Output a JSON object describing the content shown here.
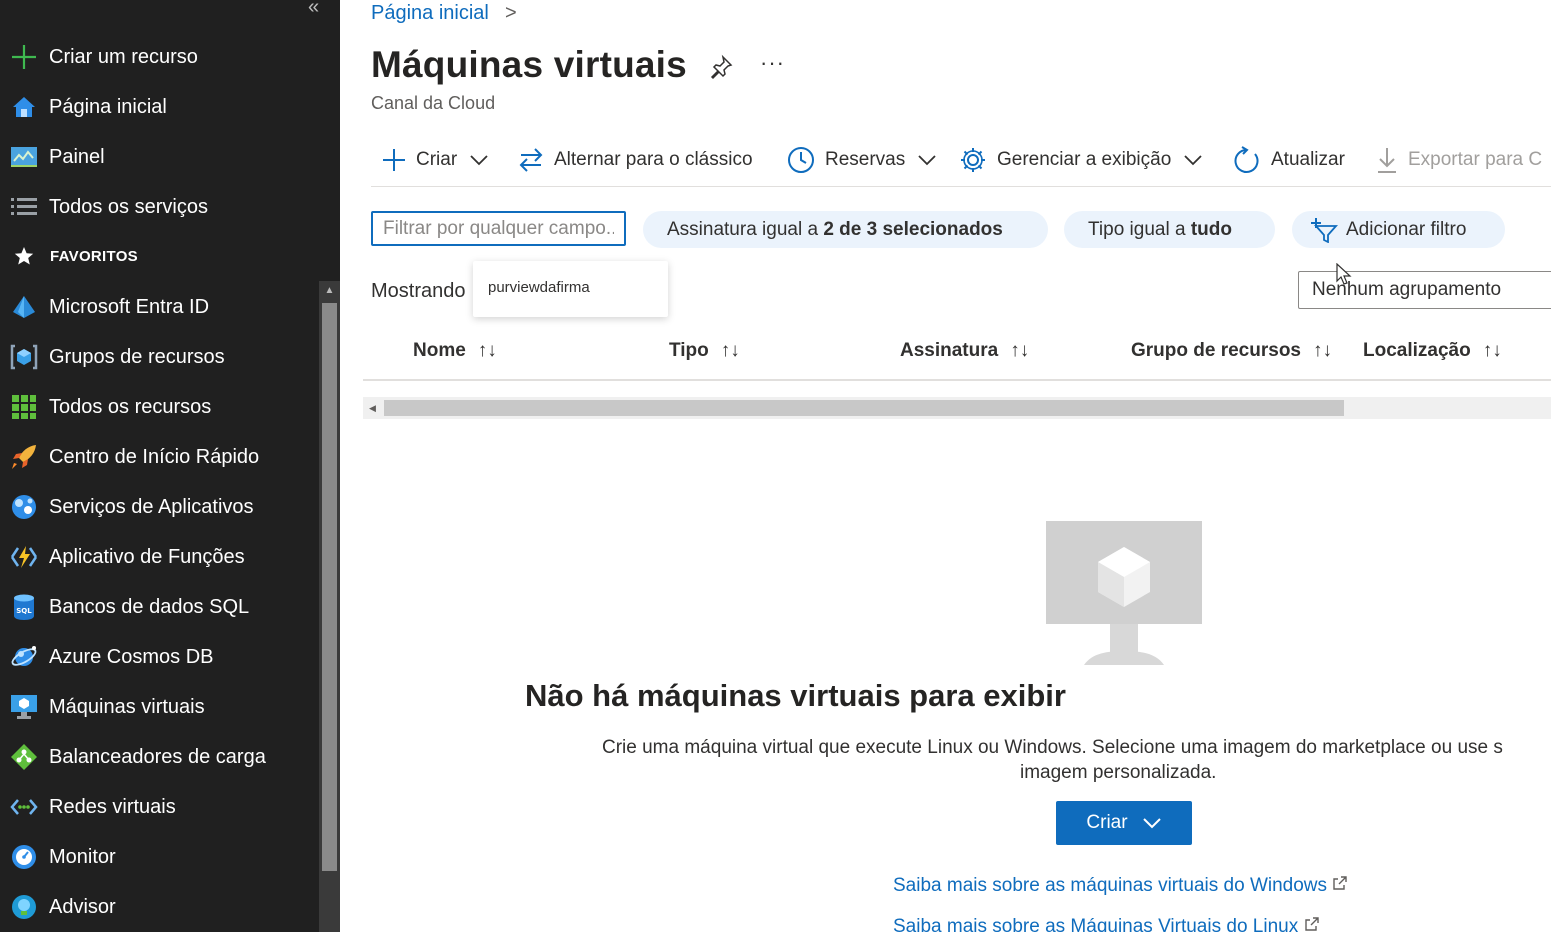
{
  "sidebar": {
    "collapse_icon": "«",
    "create_resource": "Criar um recurso",
    "home": "Página inicial",
    "dashboard": "Painel",
    "all_services": "Todos os serviços",
    "favorites_header": "FAVORITOS",
    "favorites": [
      {
        "label": "Microsoft Entra ID",
        "icon": "entra-id-icon"
      },
      {
        "label": "Grupos de recursos",
        "icon": "resource-groups-icon"
      },
      {
        "label": "Todos os recursos",
        "icon": "all-resources-icon"
      },
      {
        "label": "Centro de Início Rápido",
        "icon": "quickstart-rocket-icon"
      },
      {
        "label": "Serviços de Aplicativos",
        "icon": "app-services-icon"
      },
      {
        "label": "Aplicativo de Funções",
        "icon": "function-app-icon"
      },
      {
        "label": "Bancos de dados SQL",
        "icon": "sql-database-icon"
      },
      {
        "label": "Azure Cosmos DB",
        "icon": "cosmos-db-icon"
      },
      {
        "label": "Máquinas virtuais",
        "icon": "virtual-machine-icon"
      },
      {
        "label": "Balanceadores de carga",
        "icon": "load-balancer-icon"
      },
      {
        "label": "Redes virtuais",
        "icon": "virtual-network-icon"
      },
      {
        "label": "Monitor",
        "icon": "monitor-icon"
      },
      {
        "label": "Advisor",
        "icon": "advisor-icon"
      }
    ]
  },
  "breadcrumb": {
    "home": "Página inicial",
    "separator": ">"
  },
  "page": {
    "title": "Máquinas virtuais",
    "subtitle": "Canal da Cloud",
    "more": "···"
  },
  "toolbar": {
    "create": "Criar",
    "switch_classic": "Alternar para o clássico",
    "reservations": "Reservas",
    "manage_view": "Gerenciar a exibição",
    "refresh": "Atualizar",
    "export": "Exportar para C"
  },
  "filters": {
    "search_placeholder": "Filtrar por qualquer campo...",
    "subscription_prefix": "Assinatura igual a ",
    "subscription_value": "2 de 3 selecionados",
    "type_prefix": "Tipo igual a ",
    "type_value": "tudo",
    "add_filter": "Adicionar filtro"
  },
  "list": {
    "showing": "Mostrando",
    "suggestion": "purviewdafirma",
    "grouping": "Nenhum agrupamento",
    "columns": [
      "Nome",
      "Tipo",
      "Assinatura",
      "Grupo de recursos",
      "Localização"
    ],
    "sort_icon": "↑↓"
  },
  "empty_state": {
    "title": "Não há máquinas virtuais para exibir",
    "description_line1": "Crie uma máquina virtual que execute Linux ou Windows. Selecione uma imagem do marketplace ou use s",
    "description_line2": "imagem personalizada.",
    "create_button": "Criar",
    "link_windows": "Saiba mais sobre as máquinas virtuais do Windows",
    "link_linux": "Saiba mais sobre as Máquinas Virtuais do Linux"
  },
  "colors": {
    "accent": "#0f6cbd",
    "sidebar_bg": "#202020",
    "pill_bg": "#ebf3fc"
  }
}
